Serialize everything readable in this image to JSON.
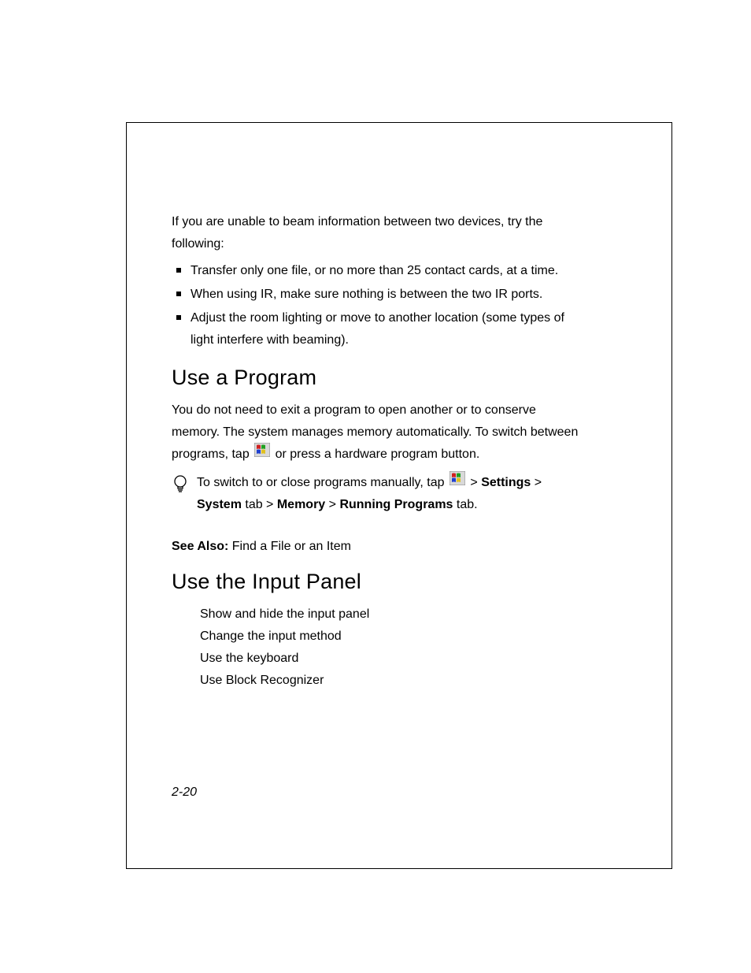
{
  "intro": "If you are unable to beam information between two devices, try the following:",
  "bullets": [
    "Transfer only one file, or no more than 25 contact cards, at a time.",
    "When using IR, make sure nothing is between the two IR ports.",
    "Adjust the room lighting or move to another location (some types of light interfere with beaming)."
  ],
  "section1": {
    "heading": "Use a Program",
    "para_before_icon": "You do not need to exit a program to open another or to conserve memory. The system manages memory automatically. To switch between programs, tap ",
    "para_after_icon": " or press a hardware program button.",
    "tip_prefix": "To switch to or close programs manually, tap ",
    "tip_sep1": " > ",
    "tip_b_settings": "Settings",
    "tip_sep2": " > ",
    "tip_b_system": "System",
    "tip_tab1": " tab > ",
    "tip_b_memory": "Memory",
    "tip_sep3": " > ",
    "tip_b_running": "Running Programs",
    "tip_tab2": " tab."
  },
  "see_also": {
    "label": "See Also:",
    "text": " Find a File or an Item"
  },
  "section2": {
    "heading": "Use the Input Panel",
    "items": [
      "Show and hide the input panel",
      "Change the input method",
      "Use the keyboard",
      "Use Block Recognizer"
    ]
  },
  "page_number": "2-20"
}
